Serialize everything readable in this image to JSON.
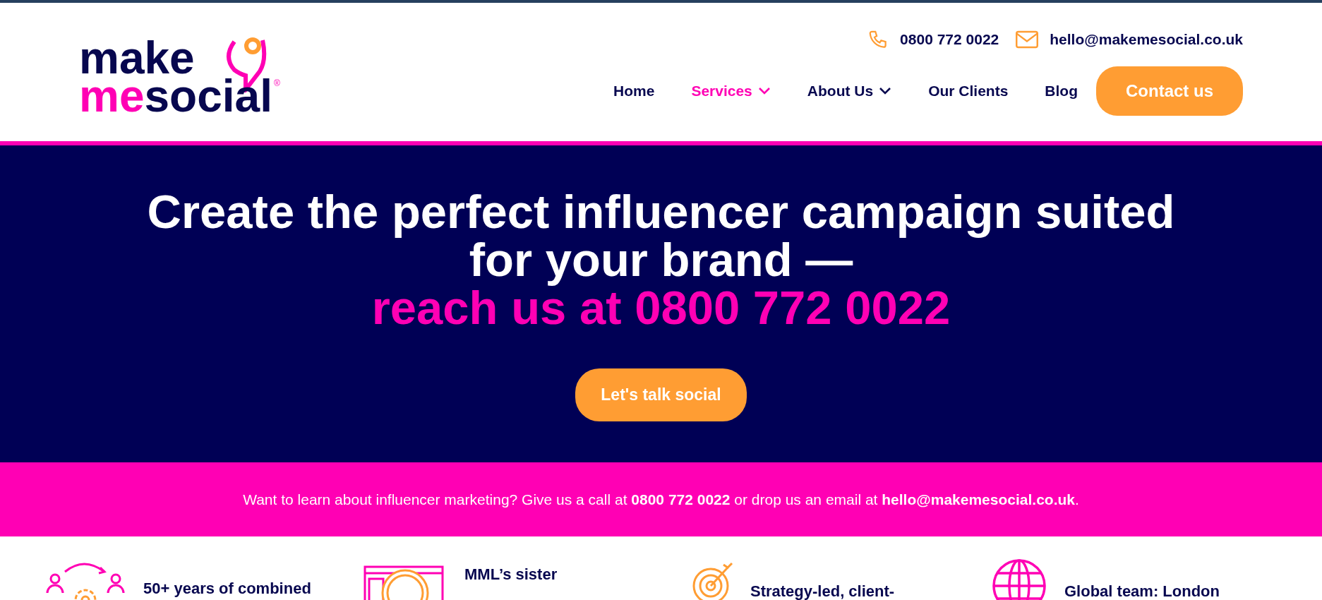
{
  "header": {
    "logo": {
      "word_top": "make",
      "word_accent": "me",
      "word_rest": "social",
      "registered": "®"
    },
    "contacts": [
      {
        "kind": "phone",
        "text": "0800 772 0022"
      },
      {
        "kind": "email",
        "text": "hello@makemesocial.co.uk"
      }
    ],
    "nav": [
      {
        "label": "Home",
        "selected": false,
        "dropdown": false
      },
      {
        "label": "Services",
        "selected": true,
        "dropdown": true
      },
      {
        "label": "About Us",
        "selected": false,
        "dropdown": true
      },
      {
        "label": "Our Clients",
        "selected": false,
        "dropdown": false
      },
      {
        "label": "Blog",
        "selected": false,
        "dropdown": false
      }
    ],
    "cta": "Contact us"
  },
  "hero": {
    "title_lines": [
      "Create the perfect influencer campaign suited",
      "for your brand —"
    ],
    "highlight": "reach us at 0800 772 0022",
    "button": "Let's talk social"
  },
  "banner": {
    "text": "Want to learn about influencer marketing? Give us a call at **0800 772 0022** or drop us an email at **hello@makemesocial.co.uk**."
  },
  "features": [
    {
      "kind": "team",
      "text": "50+ years of combined"
    },
    {
      "kind": "seo",
      "text": "MML’s sister"
    },
    {
      "kind": "target",
      "text": "Strategy-led, client-"
    },
    {
      "kind": "globe",
      "text": "Global team: London"
    }
  ]
}
